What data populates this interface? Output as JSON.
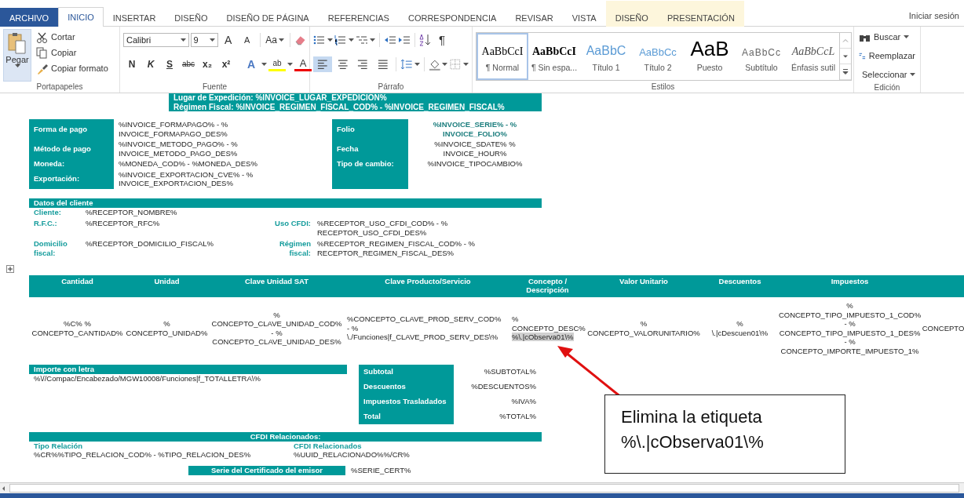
{
  "ribbon_tabs": [
    {
      "label": "ARCHIVO",
      "kind": "file",
      "selected": false
    },
    {
      "label": "INICIO",
      "kind": "normal",
      "selected": true
    },
    {
      "label": "INSERTAR",
      "kind": "normal",
      "selected": false
    },
    {
      "label": "DISEÑO",
      "kind": "normal",
      "selected": false
    },
    {
      "label": "DISEÑO DE PÁGINA",
      "kind": "normal",
      "selected": false
    },
    {
      "label": "REFERENCIAS",
      "kind": "normal",
      "selected": false
    },
    {
      "label": "CORRESPONDENCIA",
      "kind": "normal",
      "selected": false
    },
    {
      "label": "REVISAR",
      "kind": "normal",
      "selected": false
    },
    {
      "label": "VISTA",
      "kind": "normal",
      "selected": false
    },
    {
      "label": "DISEÑO",
      "kind": "contextual",
      "selected": false
    },
    {
      "label": "PRESENTACIÓN",
      "kind": "contextual",
      "selected": false
    }
  ],
  "sign_in": "Iniciar sesión",
  "clipboard": {
    "paste": "Pegar",
    "label": "Portapapeles",
    "items": [
      {
        "label": "Cortar",
        "kind": "cut"
      },
      {
        "label": "Copiar",
        "kind": "copy"
      },
      {
        "label": "Copiar formato",
        "kind": "format"
      }
    ]
  },
  "font": {
    "label": "Fuente",
    "family": "Calibri",
    "size": "9",
    "grow": "A",
    "shrink": "A",
    "case": "Aa",
    "format_buttons": [
      {
        "label": "N",
        "kind": "bold"
      },
      {
        "label": "K",
        "kind": "italic"
      },
      {
        "label": "S",
        "kind": "underline"
      },
      {
        "label": "abc",
        "kind": "strike"
      },
      {
        "label": "x₂",
        "kind": "sub"
      },
      {
        "label": "x²",
        "kind": "sup"
      }
    ],
    "effect_buttons": [
      {
        "label": "A",
        "kind": "effects"
      },
      {
        "label": "ab",
        "kind": "highlight"
      },
      {
        "label": "A",
        "kind": "color"
      }
    ]
  },
  "paragraph": {
    "label": "Párrafo",
    "pilcrow": "¶",
    "alignment": [
      {
        "kind": "left",
        "selected": true
      },
      {
        "kind": "center",
        "selected": false
      },
      {
        "kind": "right",
        "selected": false
      },
      {
        "kind": "justify",
        "selected": false
      }
    ]
  },
  "styles": {
    "label": "Estilos",
    "items": [
      {
        "sample": "AaBbCcI",
        "name": "¶ Normal",
        "kind": "normal",
        "selected": true
      },
      {
        "sample": "AaBbCcI",
        "name": "¶ Sin espa...",
        "kind": "nospace",
        "selected": false
      },
      {
        "sample": "AaBbC",
        "name": "Título 1",
        "kind": "h1",
        "selected": false
      },
      {
        "sample": "AaBbCc",
        "name": "Título 2",
        "kind": "h2",
        "selected": false
      },
      {
        "sample": "AaB",
        "name": "Puesto",
        "kind": "title",
        "selected": false
      },
      {
        "sample": "AaBbCc",
        "name": "Subtítulo",
        "kind": "subtitle",
        "selected": false
      },
      {
        "sample": "AaBbCcL",
        "name": "Énfasis sutil",
        "kind": "emphasis",
        "selected": false
      }
    ]
  },
  "editing": {
    "label": "Edición",
    "items": [
      {
        "label": "Buscar",
        "kind": "find"
      },
      {
        "label": "Reemplazar",
        "kind": "replace"
      },
      {
        "label": "Seleccionar",
        "kind": "select"
      }
    ]
  },
  "document": {
    "header_band": [
      "Lugar de Expedición: %INVOICE_LUGAR_EXPEDICION%",
      "Régimen Fiscal: %INVOICE_REGIMEN_FISCAL_COD% - %INVOICE_REGIMEN_FISCAL%"
    ],
    "payment": {
      "left": [
        {
          "label": "Forma de pago",
          "value": "%INVOICE_FORMAPAGO% -  %\nINVOICE_FORMAPAGO_DES%"
        },
        {
          "label": "Método de pago",
          "value": "%INVOICE_METODO_PAGO% -  %\nINVOICE_METODO_PAGO_DES%"
        },
        {
          "label": "Moneda:",
          "value": "%MONEDA_COD% - %MONEDA_DES%"
        },
        {
          "label": "Exportación:",
          "value": "%INVOICE_EXPORTACION_CVE% - %\nINVOICE_EXPORTACION_DES%"
        }
      ],
      "right": [
        {
          "label": "Folio",
          "value": "%INVOICE_SERIE% - %\nINVOICE_FOLIO%",
          "kind": "emphasis"
        },
        {
          "label": "Fecha",
          "value": "%INVOICE_SDATE% %\nINVOICE_HOUR%",
          "kind": "plain"
        },
        {
          "label": "Tipo de cambio:",
          "value": "%INVOICE_TIPOCAMBIO%",
          "kind": "plain"
        }
      ]
    },
    "client": {
      "title": "Datos del cliente",
      "rows": [
        {
          "label": "Cliente:",
          "value": "%RECEPTOR_NOMBRE%"
        },
        {
          "label": "R.F.C.:",
          "value": "%RECEPTOR_RFC%",
          "pair": {
            "label": "Uso CFDI:",
            "value": "%RECEPTOR_USO_CFDI_COD% - %\nRECEPTOR_USO_CFDI_DES%"
          }
        },
        {
          "label": "Domicilio\nfiscal:",
          "value": "%RECEPTOR_DOMICILIO_FISCAL%",
          "pair": {
            "label": "Régimen\nfiscal:",
            "value": "%RECEPTOR_REGIMEN_FISCAL_COD% - %\nRECEPTOR_REGIMEN_FISCAL_DES%"
          }
        }
      ]
    },
    "concepts": {
      "columns": [
        "Cantidad",
        "Unidad",
        "Clave Unidad SAT",
        "Clave Producto/Servicio",
        "Concepto /\nDescripción",
        "Valor Unitario",
        "Descuentos",
        "Impuestos"
      ],
      "row": [
        {
          "text": "%C% %\nCONCEPTO_CANTIDAD%"
        },
        {
          "text": "%\nCONCEPTO_UNIDAD%"
        },
        {
          "text": "%\nCONCEPTO_CLAVE_UNIDAD_COD%\n-  %\nCONCEPTO_CLAVE_UNIDAD_DES%"
        },
        {
          "text": "%CONCEPTO_CLAVE_PROD_SERV_COD%\n-  %\n\\./Funciones|f_CLAVE_PROD_SERV_DES\\%"
        },
        {
          "text": "%\nCONCEPTO_DESC%",
          "highlighted": "%\\.|cObserva01\\%"
        },
        {
          "text": "%\nCONCEPTO_VALORUNITARIO%"
        },
        {
          "text": "%\n\\.|cDescuen01\\%"
        },
        {
          "text": "%\nCONCEPTO_TIPO_IMPUESTO_1_COD%\n- %\nCONCEPTO_TIPO_IMPUESTO_1_DES%\n- %\nCONCEPTO_IMPORTE_IMPUESTO_1%"
        },
        {
          "text": "CONCEPTO"
        }
      ]
    },
    "amount_in_words": {
      "title": "Importe con letra",
      "value": "%\\//Compac/Encabezado/MGW10008/Funciones|f_TOTALLETRA\\%"
    },
    "totals": [
      {
        "label": "Subtotal",
        "value": "%SUBTOTAL%"
      },
      {
        "label": "Descuentos",
        "value": "%DESCUENTOS%"
      },
      {
        "label": "Impuestos Trasladados",
        "value": "%IVA%"
      },
      {
        "label": "Total",
        "value": "%TOTAL%"
      }
    ],
    "related": {
      "title": "CFDI Relacionados:",
      "items": [
        {
          "label": "Tipo Relación",
          "value": "%CR%%TIPO_RELACION_COD% - %TIPO_RELACION_DES%"
        },
        {
          "label": "CFDI Relacionados",
          "value": "%UUID_RELACIONADO%%/CR%"
        }
      ]
    },
    "certificate": {
      "label": "Serie del Certificado del emisor",
      "value": "%SERIE_CERT%"
    }
  },
  "callout": {
    "text": "Elimina la etiqueta\n%\\.|cObserva01\\%"
  }
}
